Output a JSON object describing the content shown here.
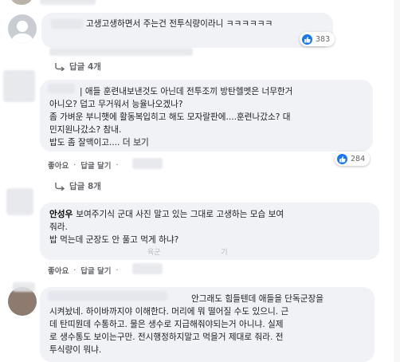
{
  "comments": [
    {
      "id": "c0",
      "author": "",
      "lines": [
        "고생고생하면서 주는건 전투식량이라니 ㅋㅋㅋㅋㅋㅋ"
      ],
      "likes": "383",
      "replies_label": "답글 4개"
    },
    {
      "id": "c1",
      "author": "",
      "lines": [
        "| 애들 훈련내보낸것도 아닌데 전투조끼 방탄헬멧은 너무한거",
        "아니오? 덥고 무거워서 능율나오겠나?",
        "좀 가벼운 부니햇에 활동복입히고 해도 모자랄판에....훈련나갔소? 대",
        "민지원나갔소? 참내.",
        "밥도 좀 잘맥이고...."
      ],
      "see_more": "더 보기",
      "likes": "284",
      "like_label": "좋아요",
      "reply_label": "답글 달기",
      "replies_label": "답글 8개"
    },
    {
      "id": "c2",
      "author": "안성우",
      "lines": [
        "보여주기식 군대 사진 말고 있는 그대로 고생하는 모습 보여",
        "줘라.",
        "밥 먹는데 군장도 안 풀고 먹게 하냐?"
      ],
      "like_label": "좋아요",
      "reply_label": "답글 달기",
      "mention_fragment": "육군",
      "mention_tail": "기"
    },
    {
      "id": "c3",
      "author": "",
      "lines": [
        "안그래도 힘들텐데 애들을 단독군장을",
        "시켜놨네. 하이바까지야 이해한다. 머리에 뭐 떨어질 수도 있으니. 근",
        "데 탄띠뭔데 수통하고. 물은 생수로 지급해줘야되는거 아니냐. 실제",
        "로 생수통도 보이는구만. 전시행정하지말고 먹을거 제대로 줘라. 전",
        "투식량이 뭐냐."
      ]
    }
  ],
  "colors": {
    "like_blue": "#1877f2",
    "bubble_bg": "#f0f2f5",
    "muted": "#65676b"
  },
  "icons": [
    "default-avatar-icon",
    "like-thumb-icon",
    "reply-arrow-icon"
  ]
}
